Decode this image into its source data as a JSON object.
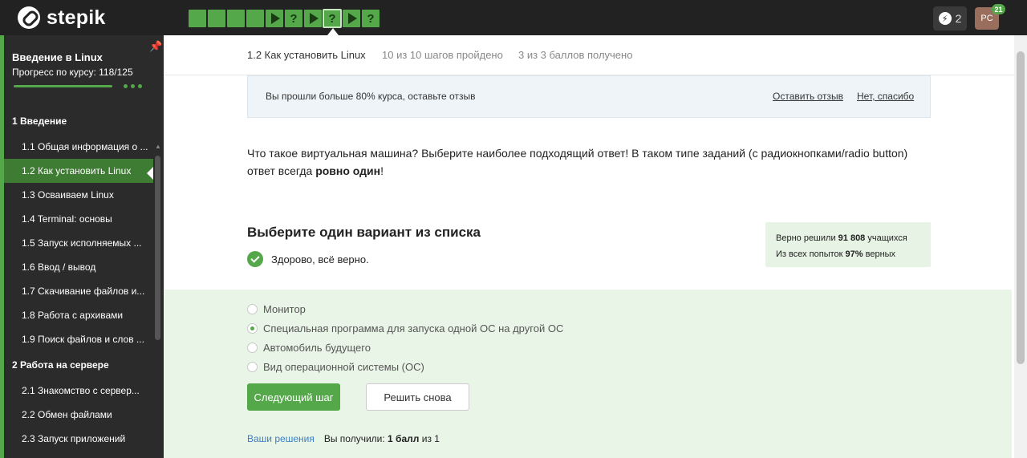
{
  "app": {
    "logo_text": "stepik"
  },
  "steps": [
    "",
    "",
    "",
    "",
    "play",
    "?",
    "play",
    "?",
    "play",
    "?"
  ],
  "energy": {
    "count": "2",
    "icon": "lightning-icon"
  },
  "user": {
    "initials": "PC",
    "badge": "21"
  },
  "sidebar": {
    "course_title": "Введение в Linux",
    "progress_text": "Прогресс по курсу:  118/125",
    "progress_fraction": 0.944,
    "sections": [
      {
        "title": "1  Введение",
        "items": [
          "1.1  Общая информация о ...",
          "1.2  Как установить Linux",
          "1.3  Осваиваем Linux",
          "1.4  Terminal: основы",
          "1.5  Запуск исполняемых ...",
          "1.6  Ввод / вывод",
          "1.7  Скачивание файлов и...",
          "1.8  Работа с архивами",
          "1.9  Поиск файлов и слов ..."
        ]
      },
      {
        "title": "2  Работа на сервере",
        "items": [
          "2.1  Знакомство с сервер...",
          "2.2  Обмен файлами",
          "2.3  Запуск приложений"
        ]
      }
    ],
    "active_item": "1.2  Как установить Linux"
  },
  "lesson": {
    "title": "1.2 Как установить Linux",
    "steps_done": "10 из 10 шагов пройдено",
    "score": "3 из 3 баллов  получено"
  },
  "banner": {
    "text": "Вы прошли больше 80% курса, оставьте отзыв",
    "leave_review": "Оставить отзыв",
    "no_thanks": "Нет, спасибо"
  },
  "question": {
    "text_before": "Что такое виртуальная машина? Выберите наиболее подходящий ответ! В таком типе заданий (с радиокнопками/radio button) ответ всегда ",
    "text_bold": "ровно один",
    "text_after": "!"
  },
  "quiz": {
    "title": "Выберите один вариант из списка",
    "feedback": "Здорово, всё верно.",
    "options": [
      {
        "label": "Монитор",
        "checked": false
      },
      {
        "label": "Специальная программа для запуска одной ОС на другой ОС",
        "checked": true
      },
      {
        "label": "Автомобиль будущего",
        "checked": false
      },
      {
        "label": "Вид операционной системы (ОС)",
        "checked": false
      }
    ],
    "next_button": "Следующий шаг",
    "retry_button": "Решить снова",
    "solutions_link": "Ваши решения",
    "result_prefix": "Вы получили:",
    "result_bold": "1 балл",
    "result_suffix": "из 1"
  },
  "stats": {
    "solved_prefix": "Верно решили",
    "solved_count": "91 808",
    "solved_suffix": "учащихся",
    "attempts_prefix": "Из всех попыток",
    "attempts_pct": "97%",
    "attempts_suffix": "верных"
  },
  "colors": {
    "brand_green": "#54a84a",
    "topbar": "#222222",
    "sidebar": "#2b2b2b"
  }
}
